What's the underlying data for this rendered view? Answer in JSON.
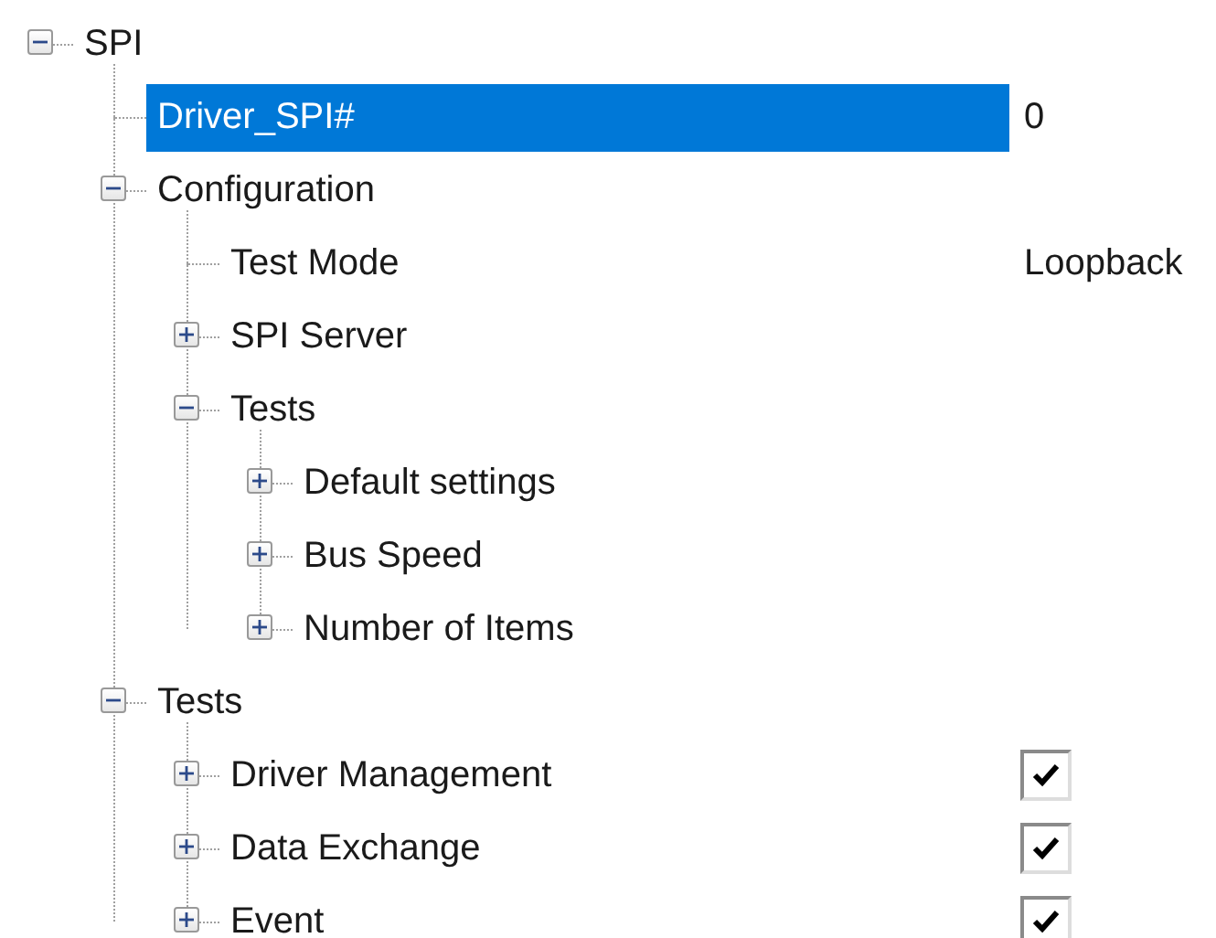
{
  "tree": [
    {
      "label": "SPI",
      "expanded": true,
      "selected": false,
      "children": [
        {
          "label": "Driver_SPI#",
          "selected": true,
          "value": "0"
        },
        {
          "label": "Configuration",
          "expanded": true,
          "selected": false,
          "children": [
            {
              "label": "Test Mode",
              "selected": false,
              "value": "Loopback"
            },
            {
              "label": "SPI Server",
              "expanded": false,
              "selected": false
            },
            {
              "label": "Tests",
              "expanded": true,
              "selected": false,
              "children": [
                {
                  "label": "Default settings",
                  "expanded": false,
                  "selected": false
                },
                {
                  "label": "Bus Speed",
                  "expanded": false,
                  "selected": false
                },
                {
                  "label": "Number of Items",
                  "expanded": false,
                  "selected": false
                }
              ]
            }
          ]
        },
        {
          "label": "Tests",
          "expanded": true,
          "selected": false,
          "children": [
            {
              "label": "Driver Management",
              "expanded": false,
              "selected": false,
              "checked": true
            },
            {
              "label": "Data Exchange",
              "expanded": false,
              "selected": false,
              "checked": true
            },
            {
              "label": "Event",
              "expanded": false,
              "selected": false,
              "checked": true
            }
          ]
        }
      ]
    }
  ]
}
